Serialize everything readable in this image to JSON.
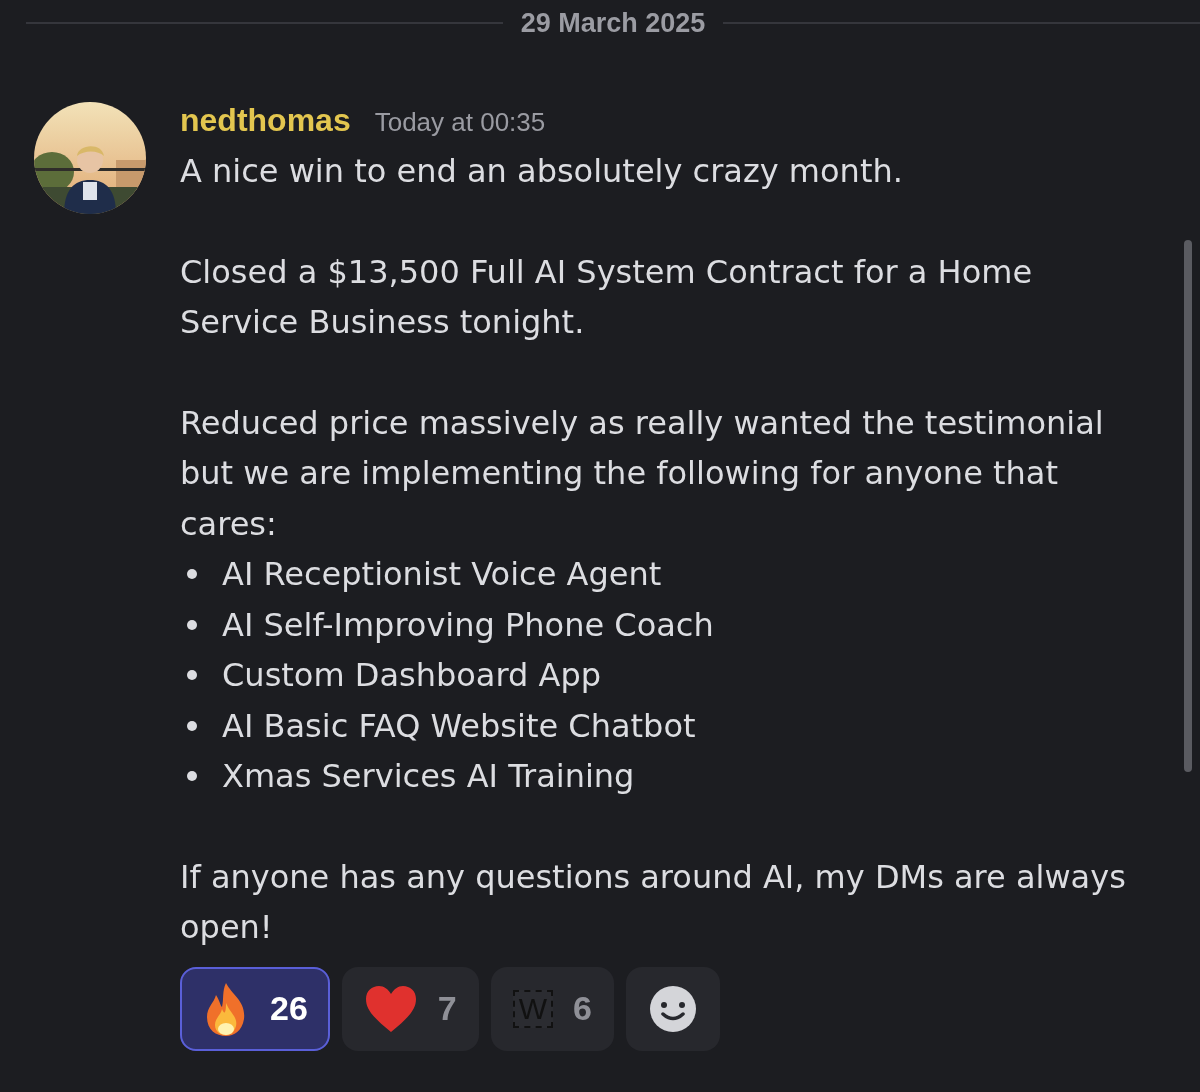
{
  "date_divider": "29 March 2025",
  "message": {
    "author": "nedthomas",
    "timestamp": "Today at 00:35",
    "body": [
      {
        "kind": "paragraph",
        "text": "A nice win to end an absolutely crazy month."
      },
      {
        "kind": "paragraph",
        "text": "Closed a $13,500 Full AI System Contract for a Home Service Business tonight."
      },
      {
        "kind": "paragraph",
        "text": "Reduced price massively as really wanted the testimonial but we are implementing the following for anyone that cares:"
      },
      {
        "kind": "list",
        "items": [
          "AI Receptionist Voice Agent",
          "AI Self-Improving Phone Coach",
          "Custom Dashboard App",
          "AI Basic FAQ Website Chatbot",
          "Xmas Services AI Training"
        ]
      },
      {
        "kind": "paragraph",
        "text": "If anyone has any questions around AI, my DMs are always open!"
      }
    ],
    "reactions": [
      {
        "kind": "fire",
        "count": "26",
        "selected": true
      },
      {
        "kind": "heart",
        "count": "7",
        "selected": false
      },
      {
        "kind": "custom",
        "label": "W",
        "count": "6",
        "selected": false
      }
    ]
  }
}
